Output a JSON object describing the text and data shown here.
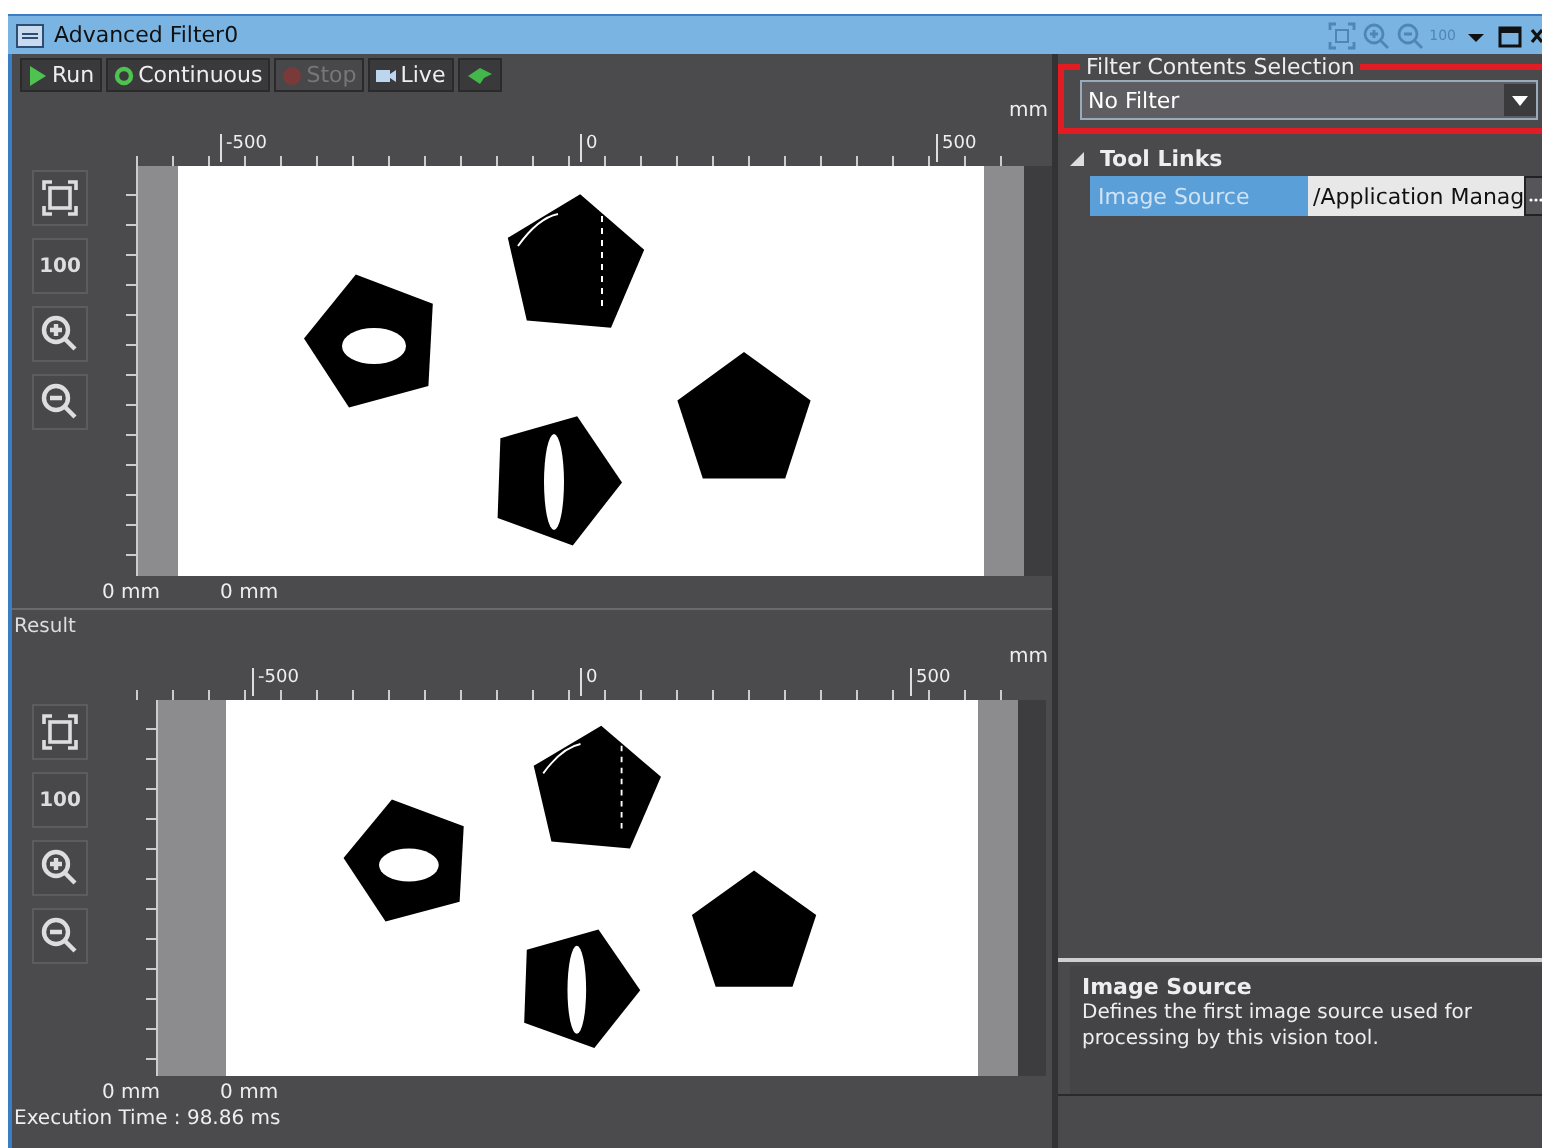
{
  "window": {
    "title": "Advanced Filter0",
    "zoom_label": "100"
  },
  "toolbar": [
    {
      "label": "Run",
      "kind": "run",
      "disabled": false
    },
    {
      "label": "Continuous",
      "kind": "continuous",
      "disabled": false
    },
    {
      "label": "Stop",
      "kind": "stop",
      "disabled": true
    },
    {
      "label": "Live",
      "kind": "live",
      "disabled": false
    },
    {
      "kind": "camera",
      "disabled": false
    }
  ],
  "viewers": [
    {
      "unit": "mm",
      "ruler_labels": [
        "-500",
        "0",
        "500"
      ],
      "zoom_label": "100",
      "readouts": [
        "0 mm",
        "0 mm"
      ]
    },
    {
      "title": "Result",
      "unit": "mm",
      "ruler_labels": [
        "-500",
        "0",
        "500"
      ],
      "zoom_label": "100",
      "readouts": [
        "0 mm",
        "0 mm"
      ]
    }
  ],
  "status": "Execution Time : 98.86 ms",
  "filter_selection": {
    "legend": "Filter Contents Selection",
    "value": "No Filter"
  },
  "tool_links": {
    "title": "Tool Links",
    "expanded": true,
    "rows": [
      {
        "name": "Image Source",
        "value": "/Application Manag",
        "selected": true
      }
    ]
  },
  "description": {
    "title": "Image Source",
    "text": "Defines the first image source used for processing by this vision tool."
  }
}
